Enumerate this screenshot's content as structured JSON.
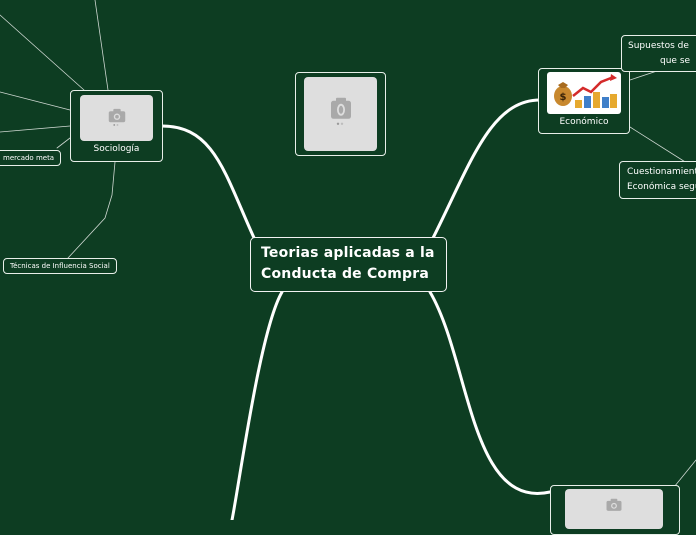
{
  "central": {
    "line1": "Teorias aplicadas a la",
    "line2": "Conducta de Compra"
  },
  "branches": {
    "sociologia": "Sociología",
    "economico": "Económico"
  },
  "subtopics": {
    "mercado_meta": "mercado meta",
    "tecnicas": "Técnicas de Influencia Social",
    "supuestos_1": "Supuestos de",
    "supuestos_2": "que se",
    "cuestionamiento_1": "Cuestionamiento",
    "cuestionamiento_2": "Económica segú"
  },
  "image_counter": "0",
  "colors": {
    "background": "#0d3d22",
    "node_border": "#e8efe9",
    "connector": "#ffffff",
    "placeholder": "#dedede"
  },
  "icons": [
    "camera-icon",
    "money-growth-icon"
  ]
}
